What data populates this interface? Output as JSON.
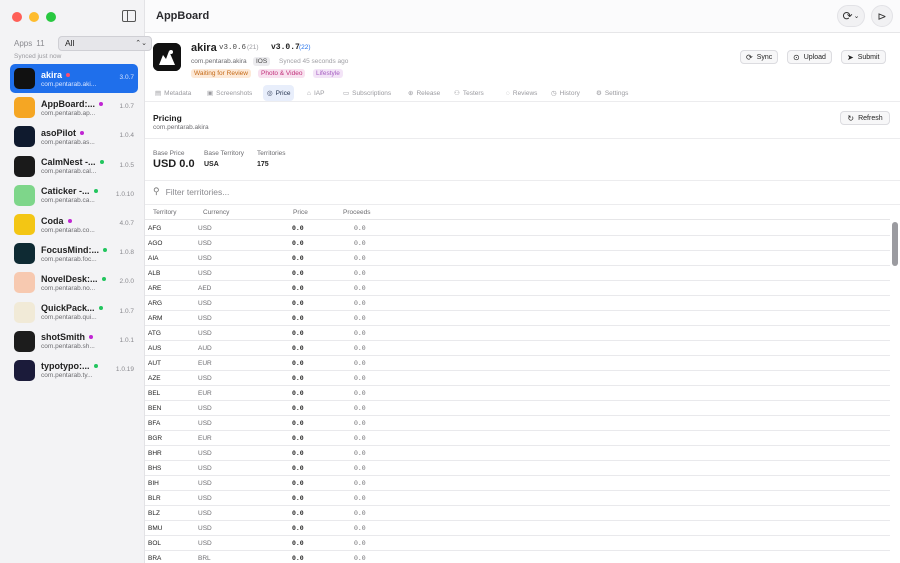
{
  "window": {
    "title": "AppBoard"
  },
  "sidebar": {
    "apps_label": "Apps",
    "apps_count": "11",
    "filter_value": "All",
    "synced_text": "Synced just now",
    "apps": [
      {
        "name": "akira",
        "bundle": "com.pentarab.aki...",
        "version": "3.0.7",
        "dot": "#ff4d6d",
        "icon_bg": "#111111",
        "active": true
      },
      {
        "name": "AppBoard:...",
        "bundle": "com.pentarab.ap...",
        "version": "1.0.7",
        "dot": "#c026d3",
        "icon_bg": "#f5a623"
      },
      {
        "name": "asoPilot",
        "bundle": "com.pentarab.as...",
        "version": "1.0.4",
        "dot": "#c026d3",
        "icon_bg": "#0f1a2e"
      },
      {
        "name": "CalmNest -...",
        "bundle": "com.pentarab.cal...",
        "version": "1.0.5",
        "dot": "#22c55e",
        "icon_bg": "#1a1a1a"
      },
      {
        "name": "Caticker -...",
        "bundle": "com.pentarab.ca...",
        "version": "1.0.10",
        "dot": "#22c55e",
        "icon_bg": "#7ed68a"
      },
      {
        "name": "Coda",
        "bundle": "com.pentarab.co...",
        "version": "4.0.7",
        "dot": "#c026d3",
        "icon_bg": "#f3c614"
      },
      {
        "name": "FocusMind:...",
        "bundle": "com.pentarab.foc...",
        "version": "1.0.8",
        "dot": "#22c55e",
        "icon_bg": "#0e2a33"
      },
      {
        "name": "NovelDesk:...",
        "bundle": "com.pentarab.no...",
        "version": "2.0.0",
        "dot": "#22c55e",
        "icon_bg": "#f7c9b0"
      },
      {
        "name": "QuickPack...",
        "bundle": "com.pentarab.qui...",
        "version": "1.0.7",
        "dot": "#22c55e",
        "icon_bg": "#f1ead7"
      },
      {
        "name": "shotSmith",
        "bundle": "com.pentarab.sh...",
        "version": "1.0.1",
        "dot": "#c026d3",
        "icon_bg": "#1c1c1c"
      },
      {
        "name": "typotypo:...",
        "bundle": "com.pentarab.ty...",
        "version": "1.0.19",
        "dot": "#22c55e",
        "icon_bg": "#1b1b3a"
      }
    ]
  },
  "header": {
    "name": "akira",
    "live_version": "v3.0.6",
    "live_build": "(21)",
    "new_version": "v3.0.7",
    "new_build": "(22)",
    "bundle": "com.pentarab.akira",
    "platform": "IOS",
    "synced": "Synced 45 seconds ago",
    "status": "Waiting for Review",
    "category1": "Photo & Video",
    "category2": "Lifestyle",
    "actions": {
      "sync": "Sync",
      "upload": "Upload",
      "submit": "Submit"
    }
  },
  "tabs": [
    {
      "label": "Metadata",
      "icon": "doc-icon",
      "glyph": "▤"
    },
    {
      "label": "Screenshots",
      "icon": "photo-icon",
      "glyph": "▣"
    },
    {
      "label": "Price",
      "icon": "dollar-icon",
      "glyph": "◎",
      "active": true
    },
    {
      "label": "IAP",
      "icon": "cart-icon",
      "glyph": "⌂"
    },
    {
      "label": "Subscriptions",
      "icon": "card-icon",
      "glyph": "▭"
    },
    {
      "label": "Release",
      "icon": "globe-icon",
      "glyph": "⊕"
    },
    {
      "label": "Testers",
      "icon": "people-icon",
      "glyph": "⚇"
    },
    {
      "label": "Reviews",
      "icon": "bubble-icon",
      "glyph": "◌"
    },
    {
      "label": "History",
      "icon": "clock-icon",
      "glyph": "◷"
    },
    {
      "label": "Settings",
      "icon": "gear-icon",
      "glyph": "⚙"
    }
  ],
  "pricing": {
    "title": "Pricing",
    "bundle": "com.pentarab.akira",
    "refresh_label": "Refresh",
    "base_price_label": "Base Price",
    "base_price_value": "USD 0.0",
    "base_territory_label": "Base Territory",
    "base_territory_value": "USA",
    "territories_label": "Territories",
    "territories_value": "175",
    "filter_placeholder": "Filter territories..."
  },
  "table": {
    "headers": {
      "territory": "Territory",
      "currency": "Currency",
      "price": "Price",
      "proceeds": "Proceeds"
    },
    "rows": [
      [
        "AFG",
        "USD",
        "0.0",
        "0.0"
      ],
      [
        "AGO",
        "USD",
        "0.0",
        "0.0"
      ],
      [
        "AIA",
        "USD",
        "0.0",
        "0.0"
      ],
      [
        "ALB",
        "USD",
        "0.0",
        "0.0"
      ],
      [
        "ARE",
        "AED",
        "0.0",
        "0.0"
      ],
      [
        "ARG",
        "USD",
        "0.0",
        "0.0"
      ],
      [
        "ARM",
        "USD",
        "0.0",
        "0.0"
      ],
      [
        "ATG",
        "USD",
        "0.0",
        "0.0"
      ],
      [
        "AUS",
        "AUD",
        "0.0",
        "0.0"
      ],
      [
        "AUT",
        "EUR",
        "0.0",
        "0.0"
      ],
      [
        "AZE",
        "USD",
        "0.0",
        "0.0"
      ],
      [
        "BEL",
        "EUR",
        "0.0",
        "0.0"
      ],
      [
        "BEN",
        "USD",
        "0.0",
        "0.0"
      ],
      [
        "BFA",
        "USD",
        "0.0",
        "0.0"
      ],
      [
        "BGR",
        "EUR",
        "0.0",
        "0.0"
      ],
      [
        "BHR",
        "USD",
        "0.0",
        "0.0"
      ],
      [
        "BHS",
        "USD",
        "0.0",
        "0.0"
      ],
      [
        "BIH",
        "USD",
        "0.0",
        "0.0"
      ],
      [
        "BLR",
        "USD",
        "0.0",
        "0.0"
      ],
      [
        "BLZ",
        "USD",
        "0.0",
        "0.0"
      ],
      [
        "BMU",
        "USD",
        "0.0",
        "0.0"
      ],
      [
        "BOL",
        "USD",
        "0.0",
        "0.0"
      ],
      [
        "BRA",
        "BRL",
        "0.0",
        "0.0"
      ]
    ]
  }
}
